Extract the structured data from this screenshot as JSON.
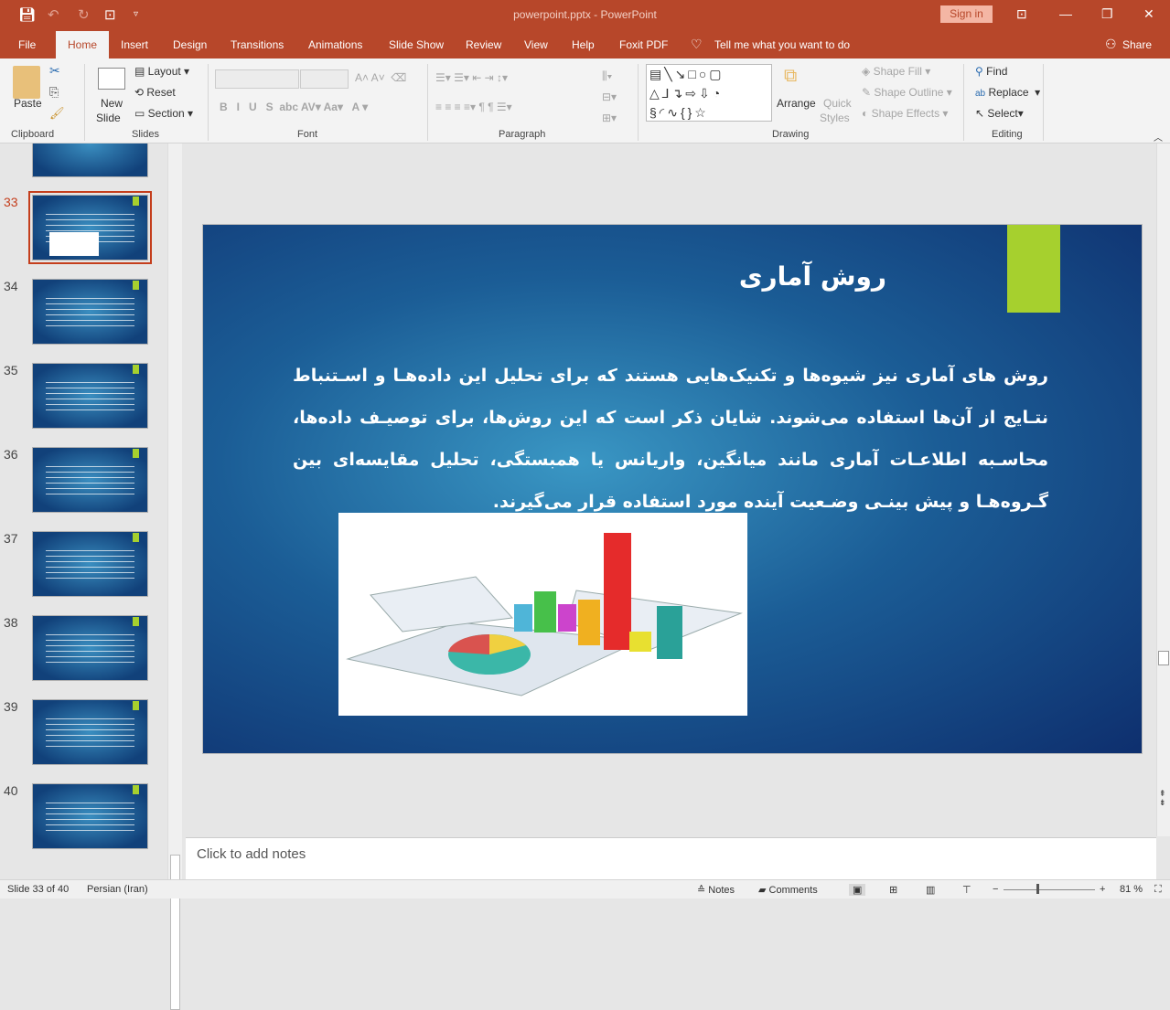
{
  "window": {
    "title": "powerpoint.pptx  -  PowerPoint",
    "sign_in": "Sign in"
  },
  "tabs": [
    "File",
    "Home",
    "Insert",
    "Design",
    "Transitions",
    "Animations",
    "Slide Show",
    "Review",
    "View",
    "Help",
    "Foxit PDF"
  ],
  "tell_me": "Tell me what you want to do",
  "share": "Share",
  "ribbon": {
    "clipboard": {
      "label": "Clipboard",
      "paste": "Paste"
    },
    "slides": {
      "label": "Slides",
      "new_slide_1": "New",
      "new_slide_2": "Slide",
      "layout": "Layout",
      "reset": "Reset",
      "section": "Section"
    },
    "font": {
      "label": "Font"
    },
    "paragraph": {
      "label": "Paragraph"
    },
    "drawing": {
      "label": "Drawing",
      "arrange": "Arrange",
      "quick_1": "Quick",
      "quick_2": "Styles",
      "shape_fill": "Shape Fill",
      "shape_outline": "Shape Outline",
      "shape_effects": "Shape Effects"
    },
    "editing": {
      "label": "Editing",
      "find": "Find",
      "replace": "Replace",
      "select": "Select"
    }
  },
  "thumbnails": [
    {
      "num": "33",
      "selected": true
    },
    {
      "num": "34"
    },
    {
      "num": "35"
    },
    {
      "num": "36"
    },
    {
      "num": "37"
    },
    {
      "num": "38"
    },
    {
      "num": "39"
    },
    {
      "num": "40"
    }
  ],
  "slide": {
    "title": "روش آماری",
    "body": "روش های آماری نیز شیوه‌ها و تکنیک‌هایی هستند که برای تحلیل این داده‌هـا و اسـتنباط نتـایج از آن‌ها استفاده می‌شوند. شایان ذکر است که این روش‌ها، برای توصیـف داده‌ها، محاسـبه اطلاعـات آماری مانند میانگین، واریانس یا همبستگی، تحلیل مقایسه‌ای بین گـروه‌هـا و پیش بینـی وضـعیت آینده مورد استفاده قرار می‌گیرند.",
    "accent": "#a6d02e"
  },
  "notes_placeholder": "Click to add notes",
  "status": {
    "slide": "Slide 33 of 40",
    "language": "Persian (Iran)",
    "notes": "Notes",
    "comments": "Comments",
    "zoom": "81 %",
    "zoom_level": 81
  },
  "colors": {
    "brand": "#b7472a"
  }
}
